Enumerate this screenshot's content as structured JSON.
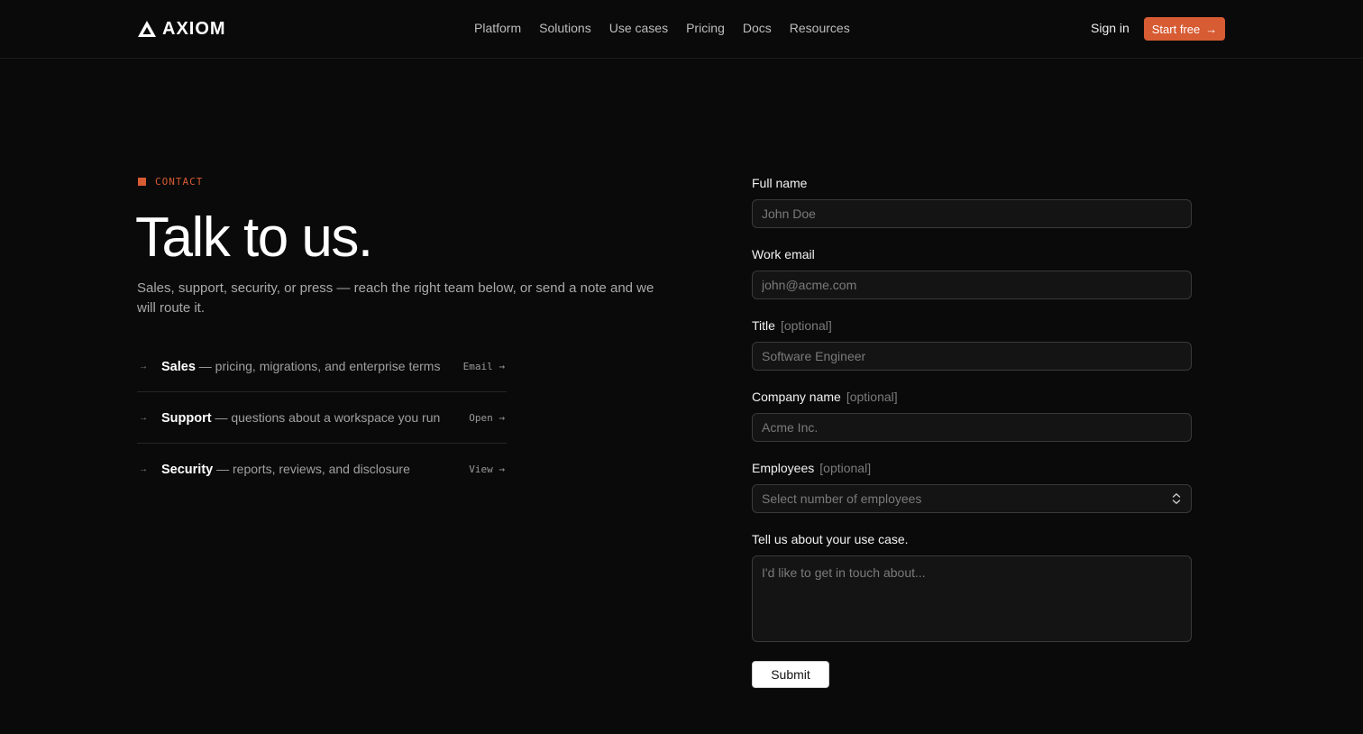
{
  "header": {
    "brand": "AXIOM",
    "nav": [
      "Platform",
      "Solutions",
      "Use cases",
      "Pricing",
      "Docs",
      "Resources"
    ],
    "sign_in": "Sign in",
    "cta": "Start free"
  },
  "hero": {
    "eyebrow": "CONTACT",
    "title": "Talk to us.",
    "lede": "Sales, support, security, or press — reach the right team below, or send a note and we will route it."
  },
  "routes": [
    {
      "name": "Sales",
      "desc": "— pricing, migrations, and enterprise terms",
      "action": "Email →"
    },
    {
      "name": "Support",
      "desc": "— questions about a workspace you run",
      "action": "Open →"
    },
    {
      "name": "Security",
      "desc": "— reports, reviews, and disclosure",
      "action": "View →"
    }
  ],
  "form": {
    "full_name": {
      "label": "Full name",
      "placeholder": "John Doe"
    },
    "work_email": {
      "label": "Work email",
      "placeholder": "john@acme.com"
    },
    "title": {
      "label": "Title",
      "optional": "[optional]",
      "placeholder": "Software Engineer"
    },
    "company": {
      "label": "Company name",
      "optional": "[optional]",
      "placeholder": "Acme Inc."
    },
    "employees": {
      "label": "Employees",
      "optional": "[optional]",
      "placeholder": "Select number of employees"
    },
    "use_case": {
      "label": "Tell us about your use case.",
      "placeholder": "I'd like to get in touch about..."
    },
    "submit": "Submit"
  },
  "colors": {
    "accent": "#d75b33",
    "background": "#0a0a0a"
  }
}
